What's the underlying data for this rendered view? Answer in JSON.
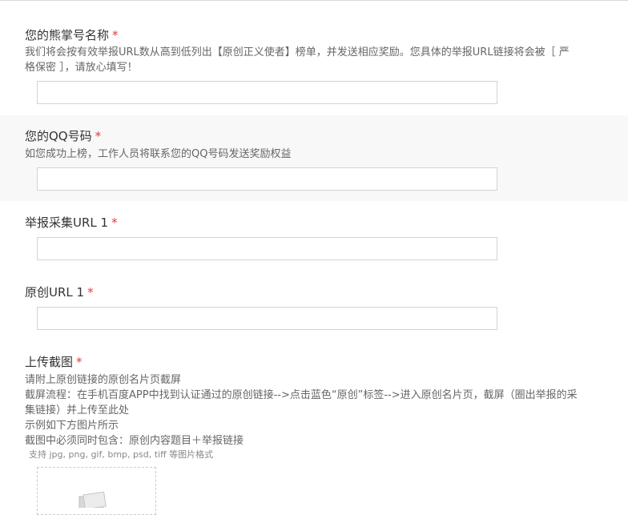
{
  "fields": [
    {
      "label": "您的熊掌号名称",
      "required": "*",
      "description": [
        "我们将会按有效举报URL数从高到低列出【原创正义使者】榜单，并发送相应奖励。您具体的举报URL链接将会被［ 严",
        "格保密 ］，请放心填写！"
      ],
      "value": ""
    },
    {
      "label": "您的QQ号码",
      "required": "*",
      "description": [
        "如您成功上榜，工作人员将联系您的QQ号码发送奖励权益"
      ],
      "value": ""
    },
    {
      "label": "举报采集URL 1",
      "required": "*",
      "value": ""
    },
    {
      "label": "原创URL 1",
      "required": "*",
      "value": ""
    },
    {
      "label": "上传截图",
      "required": "*",
      "description": [
        "请附上原创链接的原创名片页截屏",
        "截屏流程：在手机百度APP中找到认证通过的原创链接-->点击蓝色“原创”标签-->进入原创名片页，截屏（圈出举报的采",
        "集链接）并上传至此处",
        "示例如下方图片所示",
        "截图中必须同时包含：原创内容题目＋举报链接"
      ],
      "hint": "支持 jpg, png, gif, bmp, psd, tiff 等图片格式"
    }
  ],
  "colors": {
    "required": "#e4393c",
    "shaded_bg": "#f8f8f8",
    "border": "#d3d3d3"
  },
  "icons": {
    "upload": "image-placeholder-icon"
  }
}
